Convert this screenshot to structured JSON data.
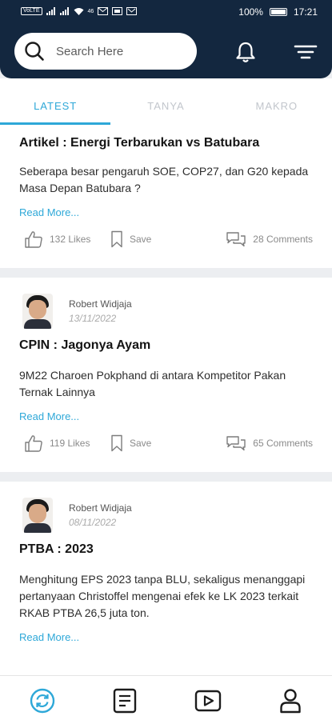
{
  "status_bar": {
    "left_chips": [
      "VoLTE",
      "46"
    ],
    "battery": "100%",
    "time": "17:21"
  },
  "header": {
    "search_placeholder": "Search Here",
    "icons": [
      "search-icon",
      "bell-icon",
      "filter-icon"
    ]
  },
  "tabs": [
    {
      "label": "LATEST",
      "active": true
    },
    {
      "label": "TANYA",
      "active": false
    },
    {
      "label": "MAKRO",
      "active": false
    }
  ],
  "posts": [
    {
      "title": "Artikel : Energi Terbarukan vs Batubara",
      "excerpt": "Seberapa besar pengaruh SOE, COP27, dan G20 kepada Masa Depan Batubara ?",
      "read_more": "Read More...",
      "likes": "132 Likes",
      "save": "Save",
      "comments": "28 Comments"
    },
    {
      "author": "Robert Widjaja",
      "date": "13/11/2022",
      "title": "CPIN : Jagonya Ayam",
      "excerpt": "9M22 Charoen Pokphand di antara Kompetitor Pakan Ternak Lainnya",
      "read_more": "Read More...",
      "likes": "119 Likes",
      "save": "Save",
      "comments": "65 Comments"
    },
    {
      "author": "Robert Widjaja",
      "date": "08/11/2022",
      "title": "PTBA : 2023",
      "excerpt": "Menghitung EPS 2023 tanpa BLU, sekaligus menanggapi pertanyaan Christoffel mengenai efek ke LK 2023 terkait RKAB PTBA 26,5 juta ton.",
      "read_more": "Read More..."
    }
  ],
  "bottom_nav": [
    "refresh-icon",
    "article-icon",
    "video-icon",
    "profile-icon"
  ],
  "colors": {
    "header": "#13273f",
    "accent": "#2ea8d8"
  }
}
